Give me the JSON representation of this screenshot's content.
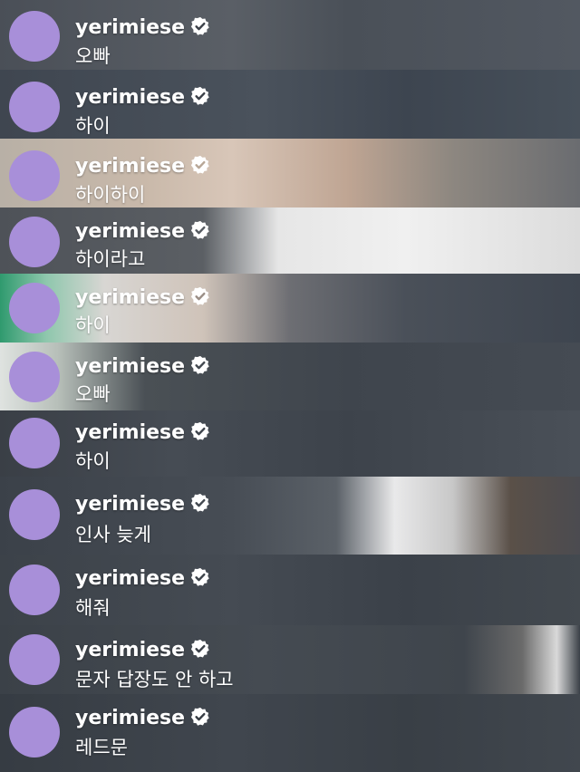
{
  "comments": [
    {
      "username": "yerimiese",
      "text": "오빠",
      "verified": true
    },
    {
      "username": "yerimiese",
      "text": "하이",
      "verified": true
    },
    {
      "username": "yerimiese",
      "text": "하이하이",
      "verified": true
    },
    {
      "username": "yerimiese",
      "text": "하이라고",
      "verified": true
    },
    {
      "username": "yerimiese",
      "text": "하이",
      "verified": true
    },
    {
      "username": "yerimiese",
      "text": "오빠",
      "verified": true
    },
    {
      "username": "yerimiese",
      "text": "하이",
      "verified": true
    },
    {
      "username": "yerimiese",
      "text": "인사 늦게",
      "verified": true
    },
    {
      "username": "yerimiese",
      "text": "해줘",
      "verified": true
    },
    {
      "username": "yerimiese",
      "text": "문자 답장도 안 하고",
      "verified": true
    },
    {
      "username": "yerimiese",
      "text": "레드문",
      "verified": true
    }
  ],
  "colors": {
    "avatar": "#a88fd9",
    "text": "#ffffff",
    "badge": "#ffffff"
  },
  "icons": {
    "verified": "verified-badge-icon"
  }
}
